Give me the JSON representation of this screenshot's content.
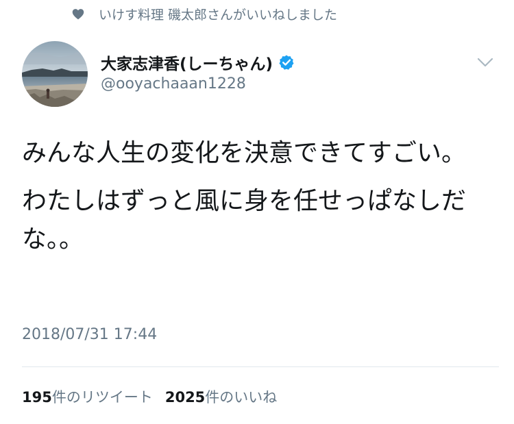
{
  "social_context": {
    "icon": "heart-icon",
    "text": "いけす料理 磯太郎さんがいいねしました"
  },
  "author": {
    "display_name": "大家志津香(しーちゃん)",
    "handle": "@ooyachaaan1228",
    "verified_icon": "verified-badge-icon"
  },
  "menu": {
    "icon": "chevron-down-icon"
  },
  "tweet": {
    "line1": "みんな人生の変化を決意できてすごい。",
    "line2": "わたしはずっと風に身を任せっぱなしだな。。",
    "timestamp": "2018/07/31 17:44"
  },
  "stats": {
    "retweets_count": "195",
    "retweets_label": "件のリツイート",
    "likes_count": "2025",
    "likes_label": "件のいいね"
  },
  "colors": {
    "primary_text": "#14171a",
    "secondary_text": "#657786",
    "verified_blue": "#1da1f2",
    "divider": "#e1e8ed"
  }
}
